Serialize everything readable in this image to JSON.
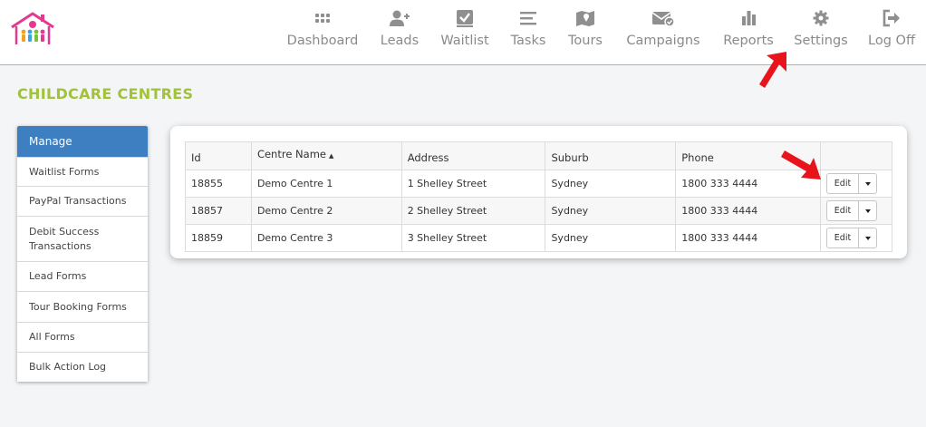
{
  "nav": {
    "items": [
      {
        "label": "Dashboard",
        "icon": "grid-icon"
      },
      {
        "label": "Leads",
        "icon": "user-plus-icon"
      },
      {
        "label": "Waitlist",
        "icon": "check-square-icon"
      },
      {
        "label": "Tasks",
        "icon": "list-icon"
      },
      {
        "label": "Tours",
        "icon": "map-icon"
      },
      {
        "label": "Campaigns",
        "icon": "envelope-check-icon"
      },
      {
        "label": "Reports",
        "icon": "bar-chart-icon"
      },
      {
        "label": "Settings",
        "icon": "gear-icon"
      },
      {
        "label": "Log Off",
        "icon": "sign-out-icon"
      }
    ]
  },
  "page": {
    "title": "CHILDCARE CENTRES"
  },
  "sidebar": {
    "header": "Manage",
    "items": [
      {
        "label": "Waitlist Forms"
      },
      {
        "label": "PayPal Transactions"
      },
      {
        "label": "Debit Success Transactions"
      },
      {
        "label": "Lead Forms"
      },
      {
        "label": "Tour Booking Forms"
      },
      {
        "label": "All Forms"
      },
      {
        "label": "Bulk Action Log"
      }
    ]
  },
  "table": {
    "columns": {
      "id": "Id",
      "name": "Centre Name",
      "sort_indicator": "▲",
      "address": "Address",
      "suburb": "Suburb",
      "phone": "Phone",
      "actions": ""
    },
    "rows": [
      {
        "id": "18855",
        "name": "Demo Centre 1",
        "address": "1 Shelley Street",
        "suburb": "Sydney",
        "phone": "1800 333 4444",
        "action": "Edit"
      },
      {
        "id": "18857",
        "name": "Demo Centre 2",
        "address": "2 Shelley Street",
        "suburb": "Sydney",
        "phone": "1800 333 4444",
        "action": "Edit"
      },
      {
        "id": "18859",
        "name": "Demo Centre 3",
        "address": "3 Shelley Street",
        "suburb": "Sydney",
        "phone": "1800 333 4444",
        "action": "Edit"
      }
    ]
  },
  "colors": {
    "accent_green": "#a2c13d",
    "sidebar_header": "#3d7fc1",
    "annotation_arrow": "#e8141b",
    "nav_icon": "#8f8f8f"
  }
}
